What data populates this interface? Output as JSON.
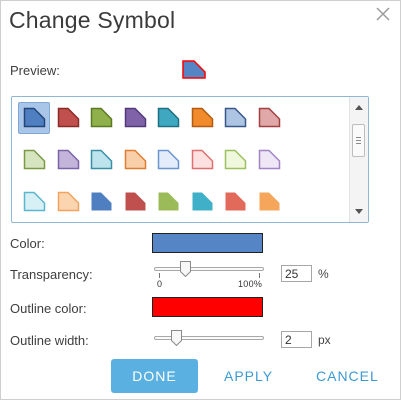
{
  "dialog": {
    "title": "Change Symbol",
    "close_icon": "close-icon"
  },
  "preview": {
    "label": "Preview:",
    "fill": "#5585c4",
    "outline": "#ff0000"
  },
  "gallery": {
    "selected_index": 0,
    "rows": [
      [
        {
          "fill": "#4f7fc0",
          "outline": "#22467a"
        },
        {
          "fill": "#c0504d",
          "outline": "#8b2a27"
        },
        {
          "fill": "#8fb04a",
          "outline": "#5b7a24"
        },
        {
          "fill": "#7f62a8",
          "outline": "#523a7a"
        },
        {
          "fill": "#3fa8c0",
          "outline": "#1d6f82"
        },
        {
          "fill": "#f08a2a",
          "outline": "#b35b10"
        },
        {
          "fill": "#adc4e3",
          "outline": "#37588a"
        },
        {
          "fill": "#e0a8a8",
          "outline": "#a04040"
        }
      ],
      [
        {
          "fill": "#d6e4bf",
          "outline": "#7a9a48"
        },
        {
          "fill": "#c3b5da",
          "outline": "#7a63a8"
        },
        {
          "fill": "#bde4ec",
          "outline": "#3a8fa6"
        },
        {
          "fill": "#f8cfa8",
          "outline": "#e07d30"
        },
        {
          "fill": "#e3ecf8",
          "outline": "#6b95cc"
        },
        {
          "fill": "#fde0e0",
          "outline": "#e07070"
        },
        {
          "fill": "#eff8dc",
          "outline": "#9cc060"
        },
        {
          "fill": "#efe6f6",
          "outline": "#a184c6"
        }
      ],
      [
        {
          "fill": "#d6f0f6",
          "outline": "#5ab7cc"
        },
        {
          "fill": "#fbd5b0",
          "outline": "#f2a45e"
        },
        {
          "fill": "#4f7fc0",
          "outline": "none"
        },
        {
          "fill": "#c0504d",
          "outline": "none"
        },
        {
          "fill": "#9bbb59",
          "outline": "none"
        },
        {
          "fill": "#3fb0c8",
          "outline": "none"
        },
        {
          "fill": "#e26a5a",
          "outline": "none"
        },
        {
          "fill": "#f6a65a",
          "outline": "none"
        }
      ],
      [
        {
          "fill": "#4f7fc0",
          "outline": "none"
        },
        {
          "fill": "#c0504d",
          "outline": "none"
        },
        {
          "fill": "#9bbb59",
          "outline": "none"
        },
        {
          "fill": "#8064a2",
          "outline": "none"
        },
        {
          "fill": "#c0504d",
          "outline": "none"
        },
        {
          "fill": "#f6a65a",
          "outline": "none"
        },
        {
          "fill": "#4f7fc0",
          "outline": "none"
        },
        {
          "fill": "#c0504d",
          "outline": "none"
        }
      ]
    ]
  },
  "color": {
    "label": "Color:",
    "value": "#5585c4"
  },
  "transparency": {
    "label": "Transparency:",
    "value": "25",
    "unit": "%",
    "min_label": "0",
    "max_label": "100%",
    "fraction": 0.25
  },
  "outline_color": {
    "label": "Outline color:",
    "value": "#ff0000"
  },
  "outline_width": {
    "label": "Outline width:",
    "value": "2",
    "unit": "px",
    "fraction": 0.17
  },
  "buttons": {
    "done": "DONE",
    "apply": "APPLY",
    "cancel": "CANCEL"
  },
  "accent": "#5ab0e0"
}
